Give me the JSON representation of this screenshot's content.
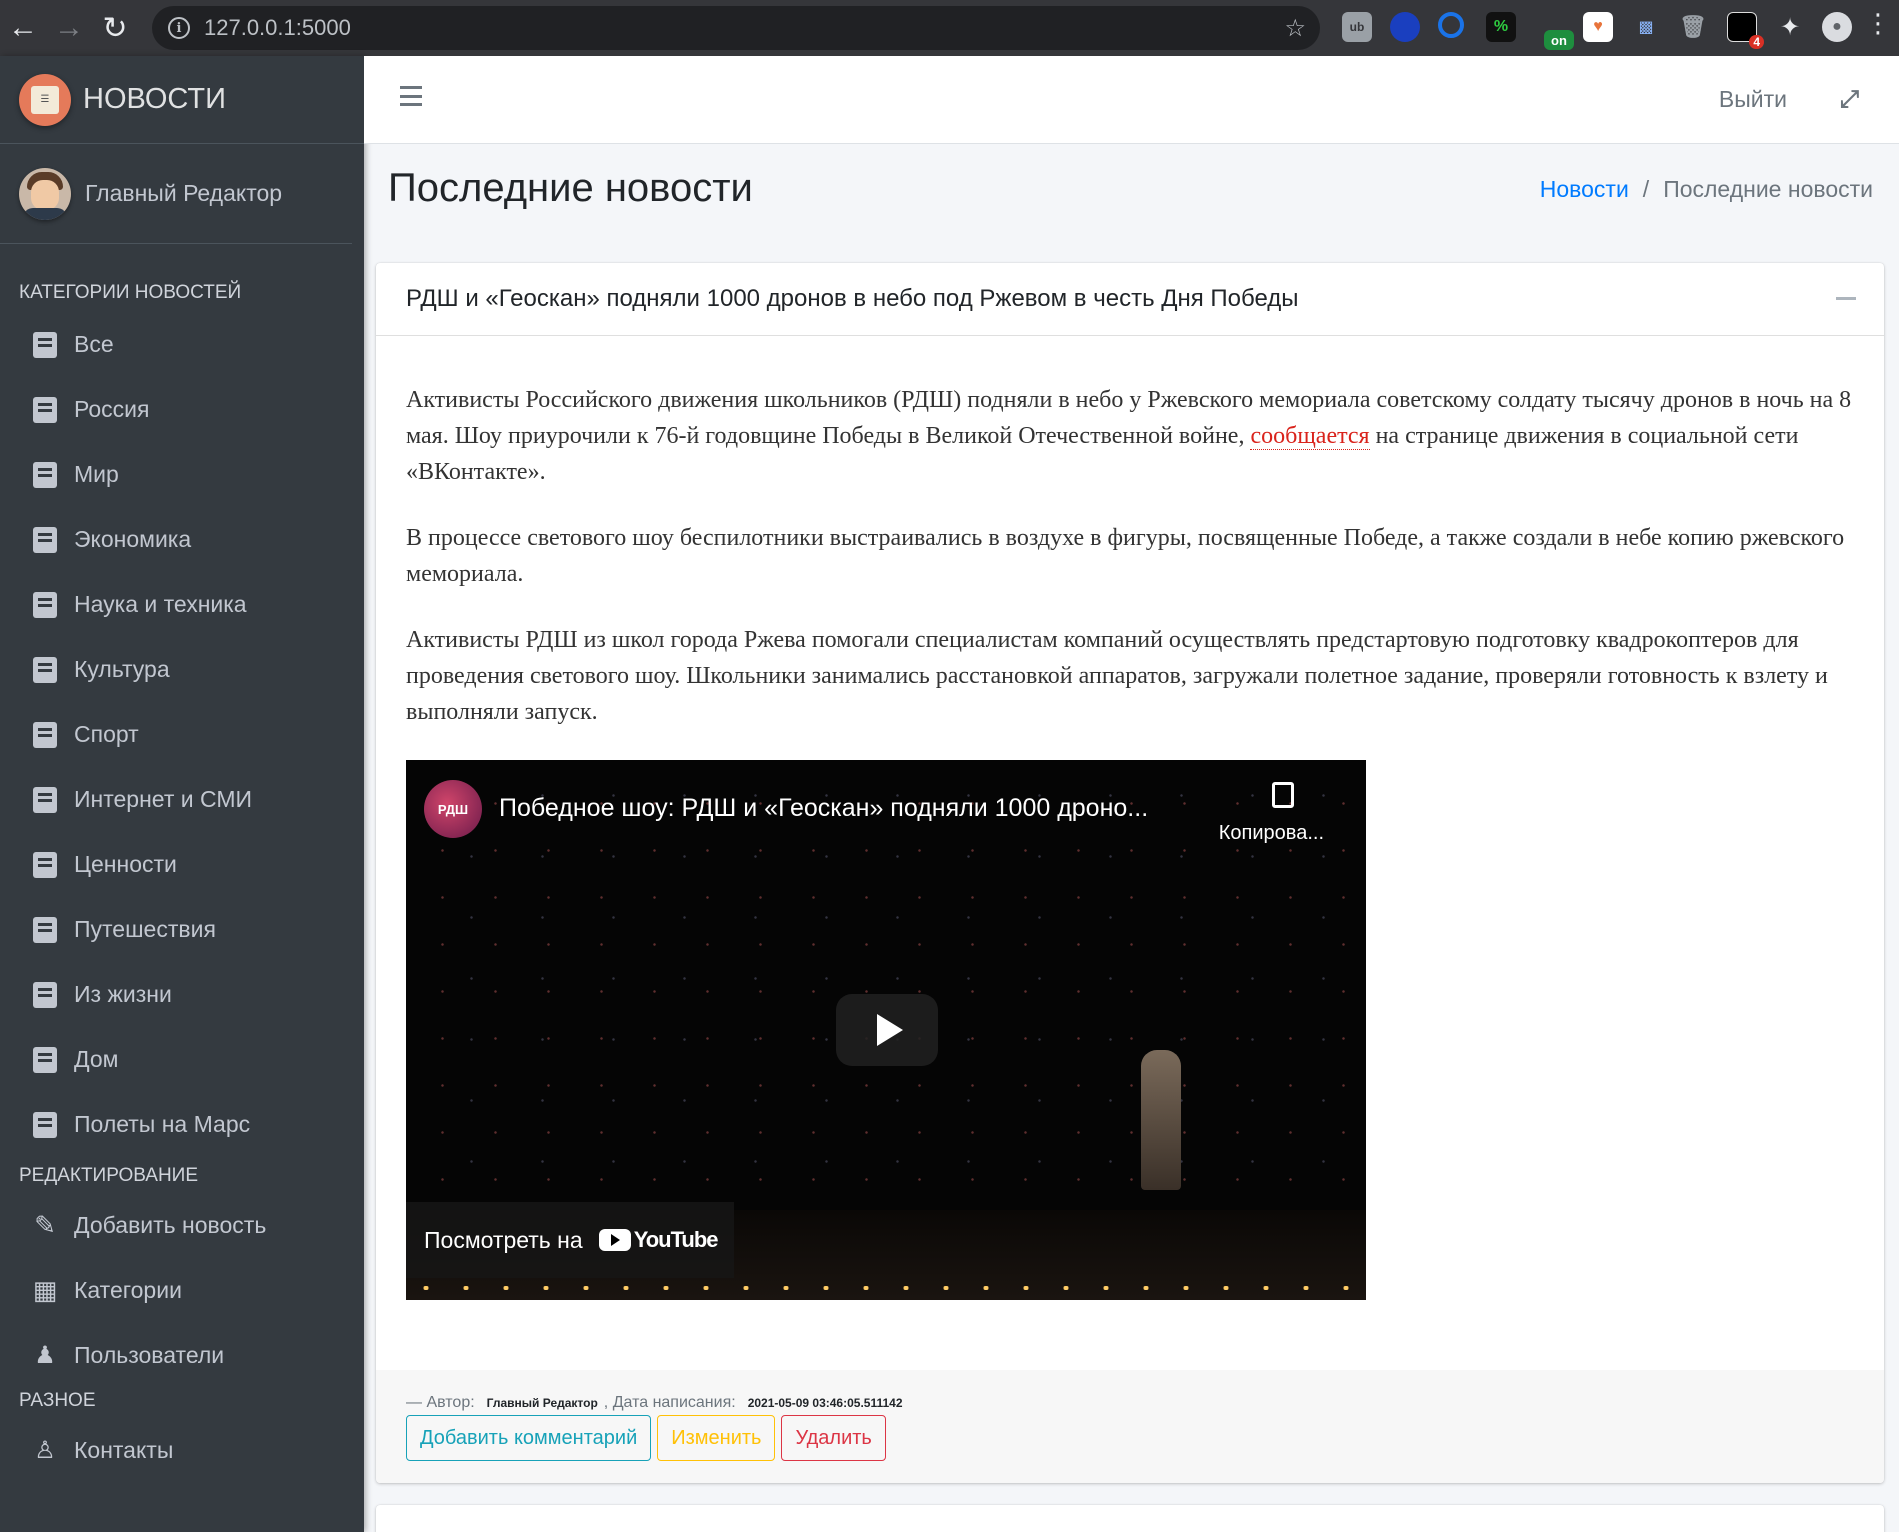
{
  "browser": {
    "url": "127.0.0.1:5000",
    "extension_badge": "4",
    "ext_on_label": "on",
    "ext_percent_label": "%"
  },
  "sidebar": {
    "brand": "НОВОСТИ",
    "user": "Главный Редактор",
    "categories_header": "КАТЕГОРИИ НОВОСТЕЙ",
    "categories": [
      {
        "label": "Все",
        "icon": "book-icon"
      },
      {
        "label": "Россия",
        "icon": "book-icon"
      },
      {
        "label": "Мир",
        "icon": "book-icon"
      },
      {
        "label": "Экономика",
        "icon": "book-icon"
      },
      {
        "label": "Наука и техника",
        "icon": "book-icon"
      },
      {
        "label": "Культура",
        "icon": "book-icon"
      },
      {
        "label": "Спорт",
        "icon": "book-icon"
      },
      {
        "label": "Интернет и СМИ",
        "icon": "book-icon"
      },
      {
        "label": "Ценности",
        "icon": "book-icon"
      },
      {
        "label": "Путешествия",
        "icon": "book-icon"
      },
      {
        "label": "Из жизни",
        "icon": "book-icon"
      },
      {
        "label": "Дом",
        "icon": "book-icon"
      },
      {
        "label": "Полеты на Марс",
        "icon": "book-icon"
      }
    ],
    "editing_header": "РЕДАКТИРОВАНИЕ",
    "editing": [
      {
        "label": "Добавить новость",
        "icon": "edit-icon"
      },
      {
        "label": "Категории",
        "icon": "grid-icon"
      },
      {
        "label": "Пользователи",
        "icon": "users-icon"
      }
    ],
    "misc_header": "РАЗНОЕ",
    "misc": [
      {
        "label": "Контакты",
        "icon": "contacts-icon"
      }
    ]
  },
  "topnav": {
    "logout": "Выйти"
  },
  "header": {
    "title": "Последние новости",
    "breadcrumb": [
      "Новости",
      "Последние новости"
    ],
    "breadcrumb_sep": "/"
  },
  "article": {
    "title": "РДШ и «Геоскан» подняли 1000 дронов в небо под Ржевом в честь Дня Победы",
    "p1_before": "Активисты Российского движения школьников (РДШ) подняли в небо у Ржевского мемориала советскому солдату тысячу дронов в ночь на 8 мая. Шоу приурочили к 76-й годовщине Победы в Великой Отечественной войне, ",
    "p1_link": "сообщается",
    "p1_after": " на странице движения в социальной сети «ВКонтакте».",
    "p2": "В процессе светового шоу беспилотники выстраивались в воздухе в фигуры, посвященные Победе, а также создали в небе копию ржевского мемориала.",
    "p3": "Активисты РДШ из школ города Ржева помогали специалистам компаний осуществлять предстартовую подготовку квадрокоптеров для проведения светового шоу. Школьники занимались расстановкой аппаратов, загружали полетное задание, проверяли готовность к взлету и выполняли запуск.",
    "video": {
      "title": "Победное шоу: РДШ и «Геоскан» подняли 1000 дроно...",
      "copy_label": "Копирова...",
      "watch_label": "Посмотреть на",
      "youtube": "YouTube",
      "channel_logo_text": "РДШ"
    },
    "meta": {
      "author_label": "— Автор:",
      "author": "Главный Редактор",
      "date_label": ", Дата написания:",
      "date": "2021-05-09 03:46:05.511142"
    },
    "buttons": {
      "comment": "Добавить комментарий",
      "edit": "Изменить",
      "delete": "Удалить"
    }
  }
}
